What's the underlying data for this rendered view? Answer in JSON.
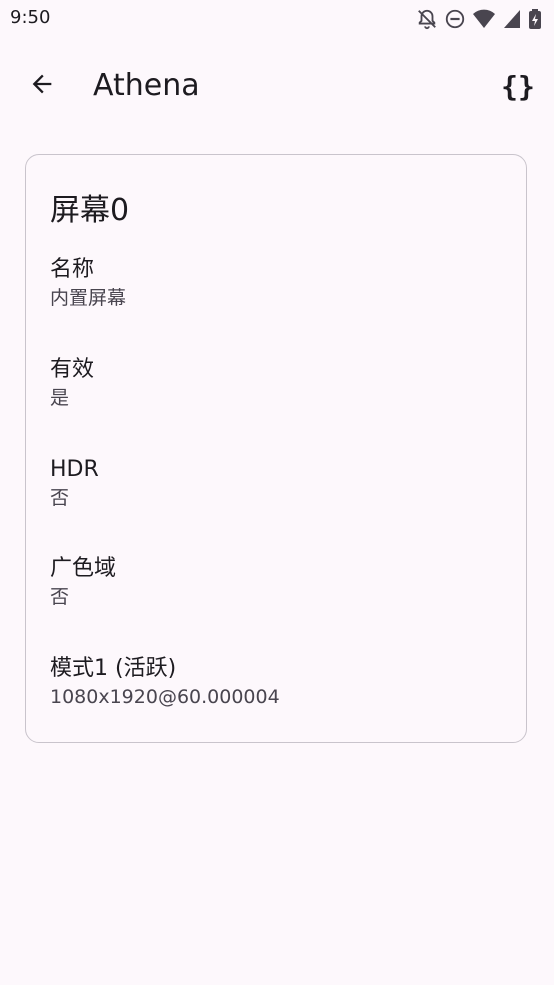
{
  "status_bar": {
    "time": "9:50",
    "icons": [
      "bell-off-icon",
      "dnd-icon",
      "wifi-icon",
      "signal-icon",
      "battery-charging-icon"
    ]
  },
  "app_bar": {
    "title": "Athena",
    "back_icon": "arrow-back-icon",
    "action_icon": "code-braces-icon",
    "action_glyph": "{}"
  },
  "card": {
    "title": "屏幕0",
    "properties": [
      {
        "label": "名称",
        "value": "内置屏幕"
      },
      {
        "label": "有效",
        "value": "是"
      },
      {
        "label": "HDR",
        "value": "否"
      },
      {
        "label": "广色域",
        "value": "否"
      },
      {
        "label": "模式1 (活跃)",
        "value": "1080x1920@60.000004"
      }
    ]
  },
  "colors": {
    "background": "#fdf8fc",
    "text_primary": "#1d1b20",
    "text_secondary": "#49454f",
    "card_border": "#c9c4cc"
  }
}
